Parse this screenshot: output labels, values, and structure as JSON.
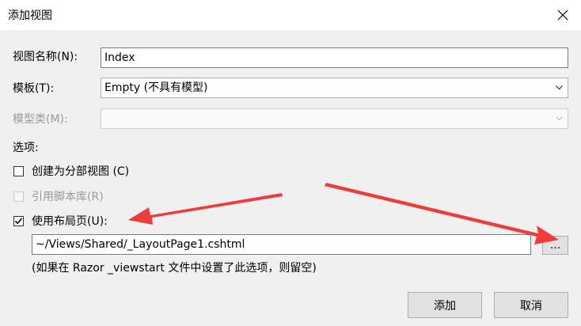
{
  "dialog": {
    "title": "添加视图",
    "view_name_label": "视图名称(N):",
    "view_name_value": "Index",
    "template_label": "模板(T):",
    "template_value": "Empty (不具有模型)",
    "model_class_label": "模型类(M):",
    "model_class_value": "",
    "options_label": "选项:",
    "create_partial_label": "创建为分部视图 (C)",
    "reference_scripts_label": "引用脚本库(R)",
    "use_layout_label": "使用布局页(U):",
    "layout_path_value": "~/Views/Shared/_LayoutPage1.cshtml",
    "browse_label": "...",
    "layout_hint": "(如果在 Razor _viewstart 文件中设置了此选项，则留空)",
    "add_button": "添加",
    "cancel_button": "取消"
  },
  "state": {
    "create_partial_checked": false,
    "reference_scripts_checked": false,
    "reference_scripts_enabled": false,
    "use_layout_checked": true,
    "model_class_enabled": false
  },
  "colors": {
    "annotation_arrow": "#ee3b3b",
    "dialog_background": "#f0f0f0",
    "button_face": "#e1e1e1"
  },
  "icons": {
    "close": "close-icon",
    "dropdown": "chevron-down-icon",
    "check": "checkmark-icon"
  }
}
